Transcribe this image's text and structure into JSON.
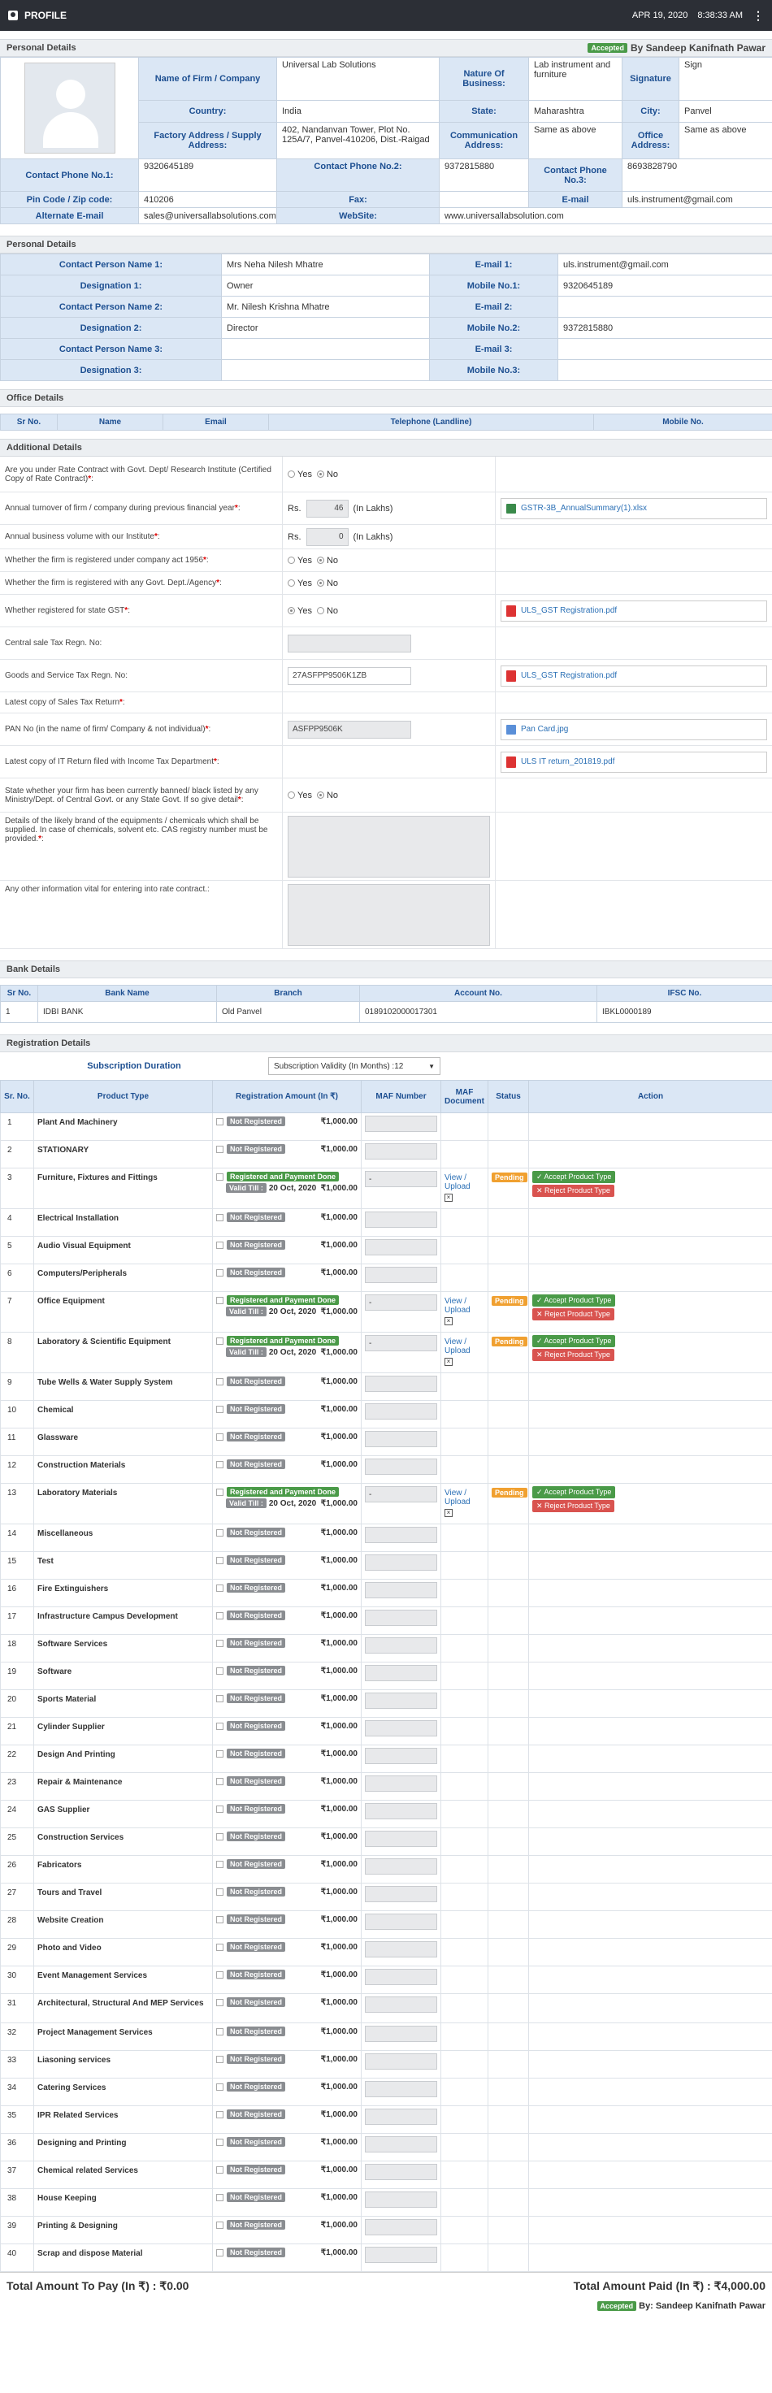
{
  "topbar": {
    "title": "PROFILE",
    "date": "APR 19, 2020",
    "time": "8:38:33 AM"
  },
  "personal": {
    "heading": "Personal Details",
    "status": "Accepted",
    "by": "By Sandeep Kanifnath Pawar",
    "firm_label": "Name of Firm / Company",
    "firm": "Universal Lab Solutions",
    "nature_label": "Nature Of Business:",
    "nature": "Lab instrument and furniture",
    "signature_label": "Signature",
    "signature": "Sign",
    "country_label": "Country:",
    "country": "India",
    "state_label": "State:",
    "state": "Maharashtra",
    "city_label": "City:",
    "city": "Panvel",
    "factory_label": "Factory Address / Supply Address:",
    "factory": "402, Nandanvan Tower, Plot No. 125A/7, Panvel-410206, Dist.-Raigad",
    "comm_label": "Communication Address:",
    "comm": "Same as above",
    "office_label": "Office Address:",
    "office": "Same as above",
    "ph1_label": "Contact Phone No.1:",
    "ph1": "9320645189",
    "ph2_label": "Contact Phone No.2:",
    "ph2": "9372815880",
    "ph3_label": "Contact Phone No.3:",
    "ph3": "8693828790",
    "pin_label": "Pin Code / Zip code:",
    "pin": "410206",
    "fax_label": "Fax:",
    "fax": "",
    "email_label": "E-mail",
    "email": "uls.instrument@gmail.com",
    "alt_label": "Alternate E-mail",
    "alt": "sales@universallabsolutions.com",
    "web_label": "WebSite:",
    "web": "www.universallabsolution.com"
  },
  "contact": {
    "heading": "Personal Details",
    "rows": [
      {
        "l1": "Contact Person Name 1:",
        "v1": "Mrs Neha Nilesh Mhatre",
        "l2": "E-mail 1:",
        "v2": "uls.instrument@gmail.com"
      },
      {
        "l1": "Designation 1:",
        "v1": "Owner",
        "l2": "Mobile No.1:",
        "v2": "9320645189"
      },
      {
        "l1": "Contact Person Name 2:",
        "v1": "Mr. Nilesh Krishna Mhatre",
        "l2": "E-mail 2:",
        "v2": ""
      },
      {
        "l1": "Designation 2:",
        "v1": "Director",
        "l2": "Mobile No.2:",
        "v2": "9372815880"
      },
      {
        "l1": "Contact Person Name 3:",
        "v1": "",
        "l2": "E-mail 3:",
        "v2": ""
      },
      {
        "l1": "Designation 3:",
        "v1": "",
        "l2": "Mobile No.3:",
        "v2": ""
      }
    ]
  },
  "office": {
    "heading": "Office Details",
    "cols": [
      "Sr No.",
      "Name",
      "Email",
      "Telephone (Landline)",
      "Mobile No."
    ]
  },
  "additional": {
    "heading": "Additional Details",
    "q1": "Are you under Rate Contract with Govt. Dept/ Research Institute (Certified Copy of Rate Contract)",
    "yes": "Yes",
    "no": "No",
    "q2": "Annual turnover of firm / company during previous financial year",
    "rs": "Rs.",
    "q2val": "46",
    "lakhs": "(In Lakhs)",
    "q2file": "GSTR-3B_AnnualSummary(1).xlsx",
    "q3": "Annual business volume with our Institute",
    "q3val": "0",
    "q4": "Whether the firm is registered under company act 1956",
    "q5": "Whether the firm is registered with any Govt. Dept./Agency",
    "q6": "Whether registered for state GST",
    "q6file": "ULS_GST Registration.pdf",
    "q7": "Central sale Tax Regn. No:",
    "q8": "Goods and Service Tax Regn. No:",
    "q8val": "27ASFPP9506K1ZB",
    "q8file": "ULS_GST Registration.pdf",
    "q9": "Latest copy of Sales Tax Return",
    "q10": "PAN No (in the name of firm/ Company & not individual)",
    "q10val": "ASFPP9506K",
    "q10file": "Pan Card.jpg",
    "q11": "Latest copy of IT Return filed with Income Tax Department",
    "q11file": "ULS IT return_201819.pdf",
    "q12": "State whether your firm has been currently banned/ black listed by any Ministry/Dept. of Central Govt. or any State Govt. If so give detail",
    "q13": "Details of the likely brand of the equipments / chemicals which shall be supplied. In case of chemicals, solvent etc. CAS registry number must be provided.",
    "q14": "Any other information vital for entering into rate contract.:"
  },
  "bank": {
    "heading": "Bank Details",
    "cols": [
      "Sr No.",
      "Bank Name",
      "Branch",
      "Account No.",
      "IFSC No."
    ],
    "row": {
      "sr": "1",
      "bank": "IDBI BANK",
      "branch": "Old Panvel",
      "acct": "0189102000017301",
      "ifsc": "IBKL0000189"
    }
  },
  "registration": {
    "heading": "Registration Details",
    "sub_label": "Subscription Duration",
    "sub_value": "Subscription Validity (In Months) :12",
    "cols": [
      "Sr. No.",
      "Product Type",
      "Registration Amount (In ₹)",
      "MAF Number",
      "MAF Document",
      "Status",
      "Action"
    ],
    "not_registered": "Not Registered",
    "registered": "Registered and Payment Done",
    "valid_till": "Valid Till :",
    "valid_date": "20 Oct, 2020",
    "amount": "₹1,000.00",
    "maf": "-",
    "view": "View / Upload",
    "pending": "Pending",
    "accept": "Accept Product Type",
    "reject": "Reject Product Type",
    "items": [
      {
        "sr": "1",
        "name": "Plant And Machinery",
        "reg": false
      },
      {
        "sr": "2",
        "name": "STATIONARY",
        "reg": false
      },
      {
        "sr": "3",
        "name": "Furniture, Fixtures and Fittings",
        "reg": true
      },
      {
        "sr": "4",
        "name": "Electrical Installation",
        "reg": false
      },
      {
        "sr": "5",
        "name": "Audio Visual Equipment",
        "reg": false
      },
      {
        "sr": "6",
        "name": "Computers/Peripherals",
        "reg": false
      },
      {
        "sr": "7",
        "name": "Office Equipment",
        "reg": true
      },
      {
        "sr": "8",
        "name": "Laboratory & Scientific Equipment",
        "reg": true
      },
      {
        "sr": "9",
        "name": "Tube Wells & Water Supply System",
        "reg": false
      },
      {
        "sr": "10",
        "name": "Chemical",
        "reg": false
      },
      {
        "sr": "11",
        "name": "Glassware",
        "reg": false
      },
      {
        "sr": "12",
        "name": "Construction Materials",
        "reg": false
      },
      {
        "sr": "13",
        "name": "Laboratory Materials",
        "reg": true
      },
      {
        "sr": "14",
        "name": "Miscellaneous",
        "reg": false
      },
      {
        "sr": "15",
        "name": "Test",
        "reg": false
      },
      {
        "sr": "16",
        "name": "Fire Extinguishers",
        "reg": false
      },
      {
        "sr": "17",
        "name": "Infrastructure Campus Development",
        "reg": false
      },
      {
        "sr": "18",
        "name": "Software Services",
        "reg": false
      },
      {
        "sr": "19",
        "name": "Software",
        "reg": false
      },
      {
        "sr": "20",
        "name": "Sports Material",
        "reg": false
      },
      {
        "sr": "21",
        "name": "Cylinder Supplier",
        "reg": false
      },
      {
        "sr": "22",
        "name": "Design And Printing",
        "reg": false
      },
      {
        "sr": "23",
        "name": "Repair & Maintenance",
        "reg": false
      },
      {
        "sr": "24",
        "name": "GAS Supplier",
        "reg": false
      },
      {
        "sr": "25",
        "name": "Construction Services",
        "reg": false
      },
      {
        "sr": "26",
        "name": "Fabricators",
        "reg": false
      },
      {
        "sr": "27",
        "name": "Tours and Travel",
        "reg": false
      },
      {
        "sr": "28",
        "name": "Website Creation",
        "reg": false
      },
      {
        "sr": "29",
        "name": "Photo and Video",
        "reg": false
      },
      {
        "sr": "30",
        "name": "Event Management Services",
        "reg": false
      },
      {
        "sr": "31",
        "name": "Architectural, Structural And MEP Services",
        "reg": false
      },
      {
        "sr": "32",
        "name": "Project Management Services",
        "reg": false
      },
      {
        "sr": "33",
        "name": "Liasoning services",
        "reg": false
      },
      {
        "sr": "34",
        "name": "Catering Services",
        "reg": false
      },
      {
        "sr": "35",
        "name": "IPR Related Services",
        "reg": false
      },
      {
        "sr": "36",
        "name": "Designing and Printing",
        "reg": false
      },
      {
        "sr": "37",
        "name": "Chemical related Services",
        "reg": false
      },
      {
        "sr": "38",
        "name": "House Keeping",
        "reg": false
      },
      {
        "sr": "39",
        "name": "Printing & Designing",
        "reg": false
      },
      {
        "sr": "40",
        "name": "Scrap and dispose Material",
        "reg": false
      }
    ]
  },
  "totals": {
    "to_pay": "Total Amount To Pay (In ₹) :  ₹0.00",
    "paid": "Total Amount Paid (In ₹) :  ₹4,000.00"
  },
  "footer": {
    "status": "Accepted",
    "by": "By: Sandeep Kanifnath Pawar"
  }
}
